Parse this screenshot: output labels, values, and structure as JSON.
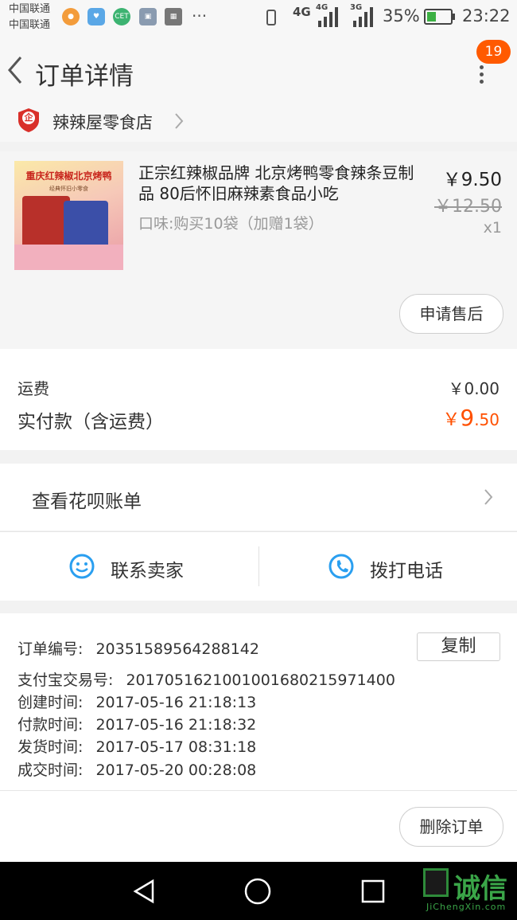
{
  "status_bar": {
    "carrier1": "中国联通",
    "carrier2": "中国联通",
    "battery": "35%",
    "time": "23:22",
    "net1": "4G",
    "net2": "4G",
    "net3": "3G",
    "cet": "CET",
    "more": "···"
  },
  "header": {
    "title": "订单详情",
    "badge": "19"
  },
  "shop": {
    "badge_char": "企",
    "name": "辣辣屋零食店"
  },
  "product": {
    "image_text": "重庆红辣椒北京烤鸭",
    "image_subtext": "经典怀旧小零食",
    "title": "正宗红辣椒品牌 北京烤鸭零食辣条豆制品 80后怀旧麻辣素食品小吃",
    "variant": "口味:购买10袋（加赠1袋）",
    "price": "￥9.50",
    "original_price": "￥12.50",
    "quantity": "x1",
    "after_sale_button": "申请售后"
  },
  "fees": {
    "shipping_label": "运费",
    "shipping_value": "￥0.00",
    "paid_label": "实付款（含运费）",
    "paid_currency": "￥",
    "paid_int": "9",
    "paid_dec": ".50"
  },
  "huabei": {
    "label": "查看花呗账单"
  },
  "contact": {
    "seller": "联系卖家",
    "phone": "拨打电话"
  },
  "details": {
    "order_no_label": "订单编号:",
    "order_no": "20351589564288142",
    "copy_button": "复制",
    "alipay_label": "支付宝交易号:",
    "alipay_no": "2017051621001001680215971400",
    "created_label": "创建时间:",
    "created": "2017-05-16 21:18:13",
    "paid_time_label": "付款时间:",
    "paid_time": "2017-05-16 21:18:32",
    "shipped_label": "发货时间:",
    "shipped": "2017-05-17 08:31:18",
    "completed_label": "成交时间:",
    "completed": "2017-05-20 00:28:08"
  },
  "actions": {
    "delete_button": "删除订单"
  },
  "watermark": {
    "text": "诚信",
    "url": "JiChengXin.com"
  },
  "colors": {
    "accent": "#ff5000",
    "badge": "#ff5a00",
    "blue_icon": "#2a9ff0"
  }
}
